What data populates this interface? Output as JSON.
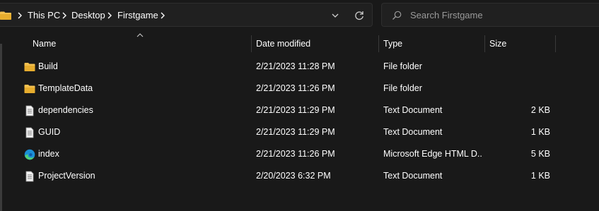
{
  "address": {
    "crumbs": [
      "This PC",
      "Desktop",
      "Firstgame"
    ],
    "icons": {
      "folder": "folder-icon",
      "separator": "chevron-right-icon",
      "history": "chevron-down-icon",
      "refresh": "refresh-icon"
    }
  },
  "search": {
    "placeholder": "Search Firstgame",
    "icon": "search-icon"
  },
  "columns": {
    "name": "Name",
    "date": "Date modified",
    "type": "Type",
    "size": "Size",
    "sorted_by": "name"
  },
  "files": [
    {
      "name": "Build",
      "date": "2/21/2023 11:28 PM",
      "type": "File folder",
      "size": "",
      "icon": "folder-icon"
    },
    {
      "name": "TemplateData",
      "date": "2/21/2023 11:26 PM",
      "type": "File folder",
      "size": "",
      "icon": "folder-icon"
    },
    {
      "name": "dependencies",
      "date": "2/21/2023 11:29 PM",
      "type": "Text Document",
      "size": "2 KB",
      "icon": "text-document-icon"
    },
    {
      "name": "GUID",
      "date": "2/21/2023 11:29 PM",
      "type": "Text Document",
      "size": "1 KB",
      "icon": "text-document-icon"
    },
    {
      "name": "index",
      "date": "2/21/2023 11:26 PM",
      "type": "Microsoft Edge HTML D...",
      "size": "5 KB",
      "icon": "edge-html-icon"
    },
    {
      "name": "ProjectVersion",
      "date": "2/20/2023 6:32 PM",
      "type": "Text Document",
      "size": "1 KB",
      "icon": "text-document-icon"
    }
  ],
  "colors": {
    "background": "#191919",
    "folder": "#f3c04f",
    "text": "#ffffff",
    "muted": "#9a9a9a"
  }
}
